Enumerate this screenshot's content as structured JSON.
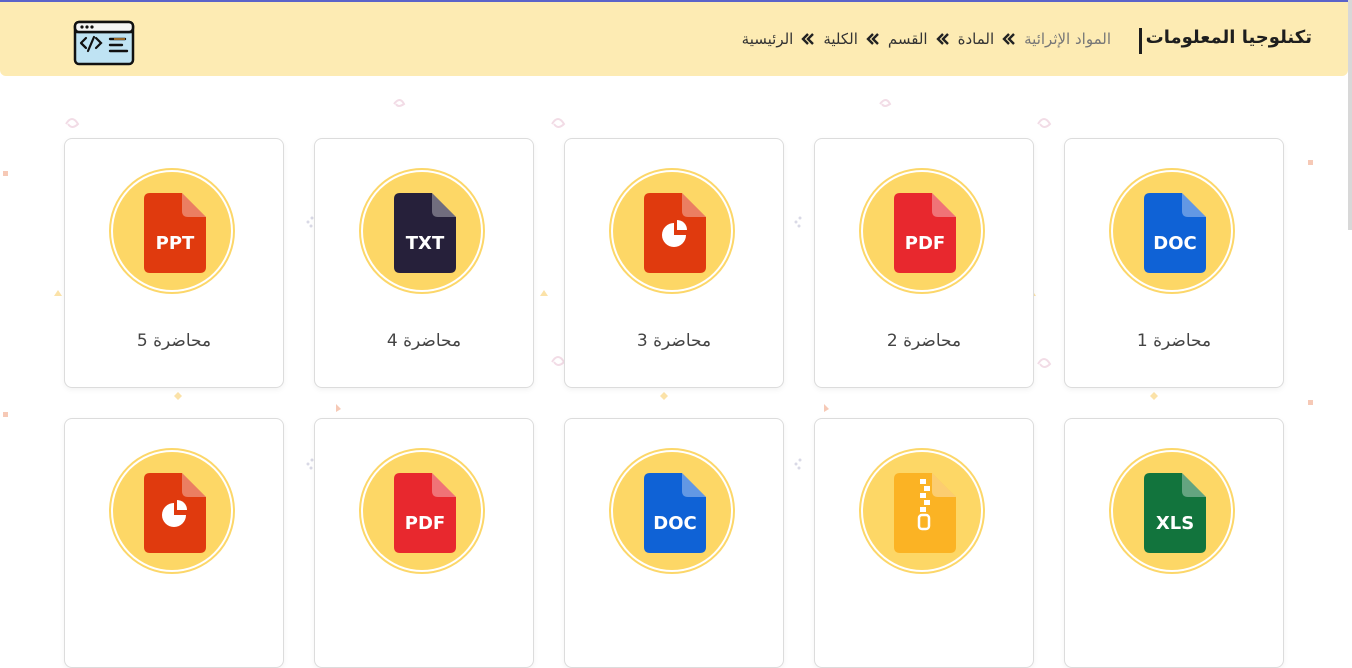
{
  "header": {
    "title": "تكنلوجيا المعلومات",
    "breadcrumb": [
      {
        "label": "الرئيسية"
      },
      {
        "label": "الكلية"
      },
      {
        "label": "القسم"
      },
      {
        "label": "المادة"
      },
      {
        "label": "المواد الإثرائية"
      }
    ],
    "logo_icon": "code-window-icon"
  },
  "cards": [
    {
      "label": "محاضرة 1",
      "file_type": "DOC",
      "icon_text": "DOC",
      "color": "#0f62d6"
    },
    {
      "label": "محاضرة 2",
      "file_type": "PDF",
      "icon_text": "PDF",
      "color": "#e8282e"
    },
    {
      "label": "محاضرة 3",
      "file_type": "PPT-chart",
      "icon_text": "",
      "color": "#e03a0e"
    },
    {
      "label": "محاضرة 4",
      "file_type": "TXT",
      "icon_text": "TXT",
      "color": "#26203a"
    },
    {
      "label": "محاضرة 5",
      "file_type": "PPT",
      "icon_text": "PPT",
      "color": "#e03a0e"
    },
    {
      "label": "",
      "file_type": "XLS",
      "icon_text": "XLS",
      "color": "#12743d"
    },
    {
      "label": "",
      "file_type": "ZIP",
      "icon_text": "",
      "color": "#fbb324"
    },
    {
      "label": "",
      "file_type": "DOC",
      "icon_text": "DOC",
      "color": "#0f62d6"
    },
    {
      "label": "",
      "file_type": "PDF",
      "icon_text": "PDF",
      "color": "#e8282e"
    },
    {
      "label": "",
      "file_type": "PPT-chart",
      "icon_text": "",
      "color": "#e03a0e"
    }
  ],
  "colors": {
    "header_bg": "#fdebb3",
    "accent_circle": "#fdd766",
    "nav_accent": "#5b63c9"
  }
}
